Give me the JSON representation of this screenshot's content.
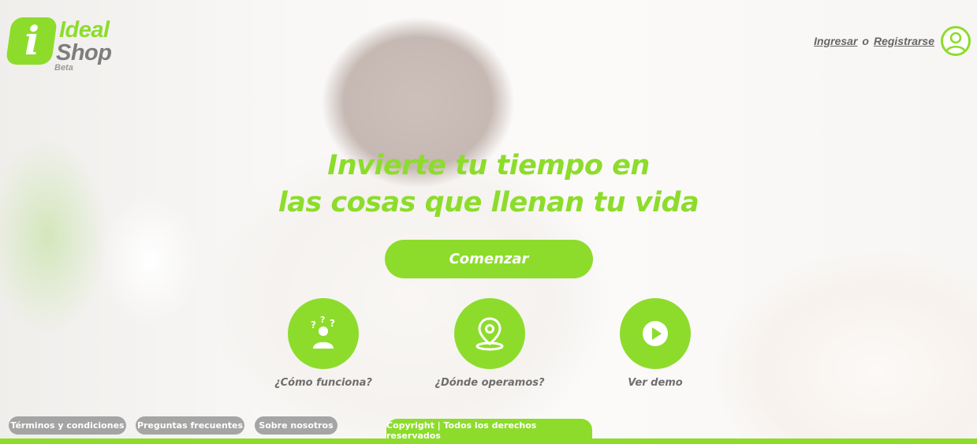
{
  "brand": {
    "logo_letter": "i",
    "name_line1": "Ideal",
    "name_line2": "Shop",
    "tag": "Beta",
    "accent_color": "#8ddc2c"
  },
  "header": {
    "login_label": "Ingresar",
    "or_label": "o",
    "register_label": "Registrarse",
    "user_icon": "user-circle-icon"
  },
  "hero": {
    "headline_line1": "Invierte tu tiempo en",
    "headline_line2": "las cosas que llenan tu vida",
    "cta_label": "Comenzar"
  },
  "features": [
    {
      "label": "¿Cómo funciona?",
      "icon": "question-person-icon"
    },
    {
      "label": "¿Dónde operamos?",
      "icon": "map-pin-icon"
    },
    {
      "label": "Ver demo",
      "icon": "play-icon"
    }
  ],
  "footer": {
    "links": [
      "Términos y condiciones",
      "Preguntas frecuentes",
      "Sobre nosotros"
    ],
    "copyright": "Copyright | Todos los derechos reservados"
  }
}
